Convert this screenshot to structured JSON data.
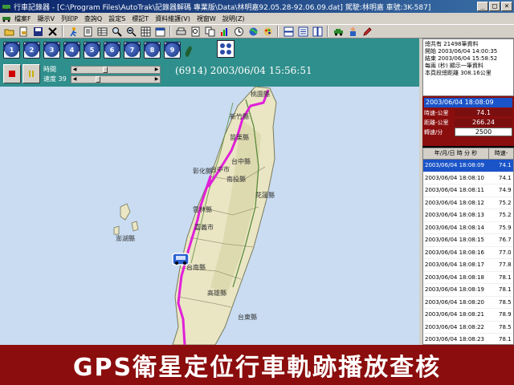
{
  "window": {
    "title": "行車記錄器 - [C:\\Program Files\\AutoTrak\\記錄器解碼 專業版\\Data\\林明嘉92.05.28-92.06.09.dat]  駕駛:林明嘉  車號:3K-587]",
    "buttons": [
      "_",
      "□",
      "×"
    ]
  },
  "menu": {
    "items": [
      "檔案F",
      "顯示V",
      "列印P",
      "查詢Q",
      "設定S",
      "標記T",
      "資料維護(V)",
      "視窗W",
      "說明(Z)"
    ]
  },
  "numbered_buttons": [
    "1",
    "2",
    "3",
    "4",
    "5",
    "6",
    "7",
    "8",
    "9"
  ],
  "playback": {
    "time_label": "時間",
    "speed_label": "速度 39",
    "time_slider_position": 0.35,
    "speed_slider_position": 0.25,
    "status": "(6914) 2003/06/04 15:56:51"
  },
  "info": {
    "lines": [
      "總共有 21498筆資料",
      "開始 2003/06/04 14:00:35",
      "結束 2003/06/04 15:58:52",
      "每兩 (秒) 顯示一筆資料",
      "本頁段總距離     308.16公里"
    ]
  },
  "stats": {
    "date": "2003/06/04 18:08:09",
    "speed_label": "時速-公里",
    "speed_value": "74.1",
    "distance_label": "距離-公里",
    "distance_value": "266.24",
    "rpm_label": "轉速/分",
    "rpm_value": "2500"
  },
  "log": {
    "col1": "年/月/日 時 分 秒",
    "col2": "時速-",
    "rows": [
      {
        "time": "2003/06/04 18:08:09",
        "speed": "74.1"
      },
      {
        "time": "2003/06/04 18:08:10",
        "speed": "74.1"
      },
      {
        "time": "2003/06/04 18:08:11",
        "speed": "74.9"
      },
      {
        "time": "2003/06/04 18:08:12",
        "speed": "75.2"
      },
      {
        "time": "2003/06/04 18:08:13",
        "speed": "75.2"
      },
      {
        "time": "2003/06/04 18:08:14",
        "speed": "75.9"
      },
      {
        "time": "2003/06/04 18:08:15",
        "speed": "76.7"
      },
      {
        "time": "2003/06/04 18:08:16",
        "speed": "77.0"
      },
      {
        "time": "2003/06/04 18:08:17",
        "speed": "77.8"
      },
      {
        "time": "2003/06/04 18:08:18",
        "speed": "78.1"
      },
      {
        "time": "2003/06/04 18:08:19",
        "speed": "78.1"
      },
      {
        "time": "2003/06/04 18:08:20",
        "speed": "78.5"
      },
      {
        "time": "2003/06/04 18:08:21",
        "speed": "78.9"
      },
      {
        "time": "2003/06/04 18:08:22",
        "speed": "78.5"
      },
      {
        "time": "2003/06/04 18:08:23",
        "speed": "78.1"
      }
    ]
  },
  "map": {
    "labels": [
      "桃園縣",
      "新竹縣",
      "苗栗縣",
      "台中縣",
      "台中市",
      "彰化縣",
      "南投縣",
      "花蓮縣",
      "雲林縣",
      "嘉義市",
      "澎湖縣",
      "台南縣",
      "高雄縣",
      "台東縣"
    ],
    "route_color": "#e020d8"
  },
  "caption": "GPS衛星定位行車軌跡播放查核"
}
